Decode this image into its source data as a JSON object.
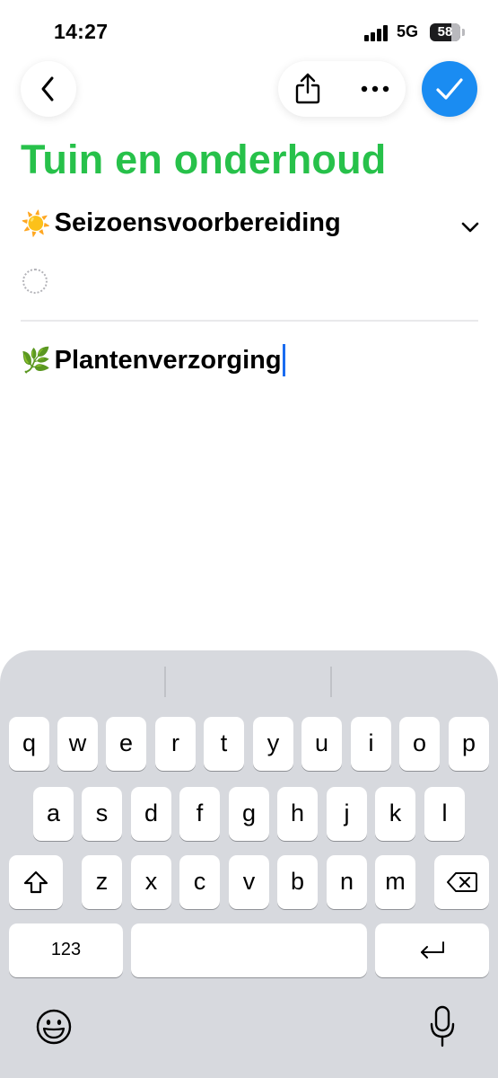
{
  "status_bar": {
    "time": "14:27",
    "network": "5G",
    "battery": "58"
  },
  "toolbar": {
    "back_icon": "chevron-left-icon",
    "share_icon": "share-icon",
    "more_icon": "ellipsis-icon",
    "done_icon": "checkmark-icon",
    "done_color": "#1a8cf2"
  },
  "note": {
    "title": "Tuin en onderhoud",
    "title_color": "#27c14a",
    "sections": [
      {
        "emoji": "☀️",
        "heading": "Seizoensvoorbereiding",
        "collapsible": true
      },
      {
        "emoji": "🌿",
        "heading": "Plantenverzorging"
      }
    ]
  },
  "keyboard": {
    "row1": [
      "q",
      "w",
      "e",
      "r",
      "t",
      "y",
      "u",
      "i",
      "o",
      "p"
    ],
    "row2": [
      "a",
      "s",
      "d",
      "f",
      "g",
      "h",
      "j",
      "k",
      "l"
    ],
    "row3": [
      "z",
      "x",
      "c",
      "v",
      "b",
      "n",
      "m"
    ],
    "numbers_label": "123"
  }
}
